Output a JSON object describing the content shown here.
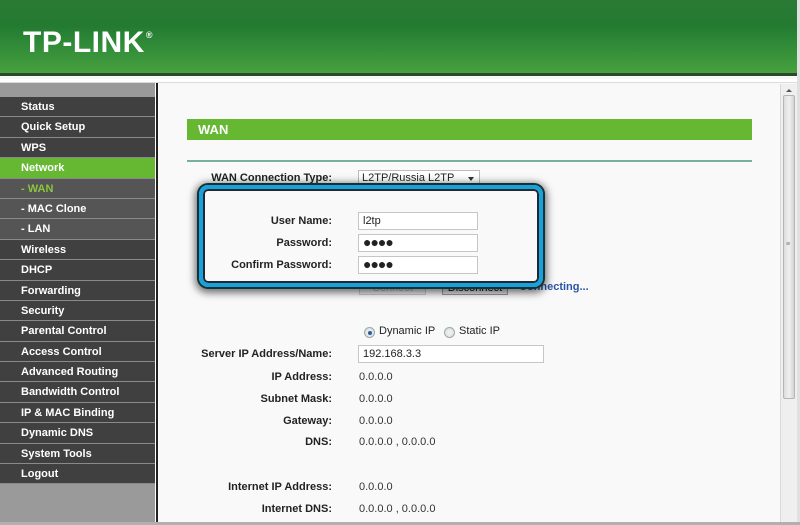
{
  "brand": {
    "logo_text": "TP-LINK",
    "registered_mark": "®",
    "header_color": "#2b7a35",
    "accent_green": "#66b832",
    "highlight_color": "#1aa0dc"
  },
  "sidebar": {
    "items": [
      {
        "label": "Status",
        "type": "top"
      },
      {
        "label": "Quick Setup",
        "type": "top"
      },
      {
        "label": "WPS",
        "type": "top"
      },
      {
        "label": "Network",
        "type": "top",
        "active": true
      },
      {
        "label": "- WAN",
        "type": "sub",
        "current": true
      },
      {
        "label": "- MAC Clone",
        "type": "sub"
      },
      {
        "label": "- LAN",
        "type": "sub"
      },
      {
        "label": "Wireless",
        "type": "top"
      },
      {
        "label": "DHCP",
        "type": "top"
      },
      {
        "label": "Forwarding",
        "type": "top"
      },
      {
        "label": "Security",
        "type": "top"
      },
      {
        "label": "Parental Control",
        "type": "top"
      },
      {
        "label": "Access Control",
        "type": "top"
      },
      {
        "label": "Advanced Routing",
        "type": "top"
      },
      {
        "label": "Bandwidth Control",
        "type": "top"
      },
      {
        "label": "IP & MAC Binding",
        "type": "top"
      },
      {
        "label": "Dynamic DNS",
        "type": "top"
      },
      {
        "label": "System Tools",
        "type": "top"
      },
      {
        "label": "Logout",
        "type": "top"
      }
    ]
  },
  "main": {
    "section_title": "WAN",
    "connection_type": {
      "label": "WAN Connection Type:",
      "value": "L2TP/Russia L2TP"
    },
    "user_name": {
      "label": "User Name:",
      "value": "l2tp"
    },
    "password": {
      "label": "Password:",
      "value": "●●●●"
    },
    "confirm_password": {
      "label": "Confirm Password:",
      "value": "●●●●"
    },
    "buttons": {
      "connect": "Connect",
      "disconnect": "Disconnect"
    },
    "connection_status": "Connecting...",
    "ip_mode": {
      "dynamic": "Dynamic IP",
      "static": "Static IP",
      "selected": "Dynamic IP"
    },
    "server": {
      "label": "Server IP Address/Name:",
      "value": "192.168.3.3"
    },
    "ip_address": {
      "label": "IP Address:",
      "value": "0.0.0.0"
    },
    "subnet_mask": {
      "label": "Subnet Mask:",
      "value": "0.0.0.0"
    },
    "gateway": {
      "label": "Gateway:",
      "value": "0.0.0.0"
    },
    "dns": {
      "label": "DNS:",
      "value": "0.0.0.0 , 0.0.0.0"
    },
    "internet_ip": {
      "label": "Internet IP Address:",
      "value": "0.0.0.0"
    },
    "internet_dns": {
      "label": "Internet DNS:",
      "value": "0.0.0.0 , 0.0.0.0"
    }
  }
}
